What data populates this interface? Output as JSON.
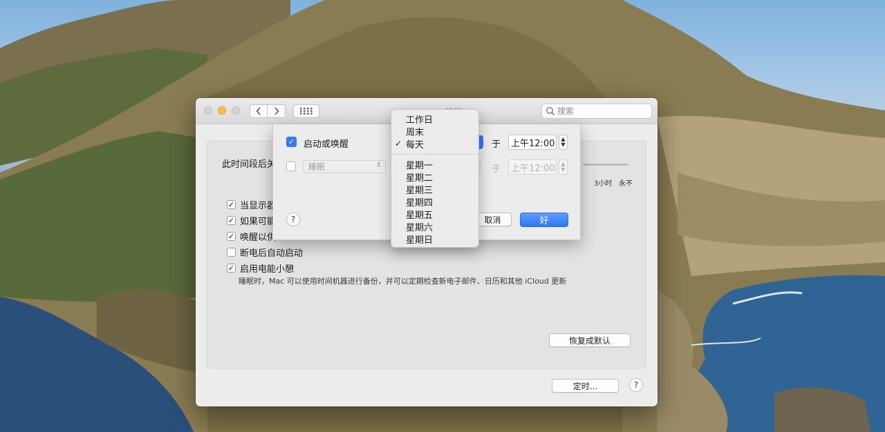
{
  "window": {
    "title": "节能",
    "search_placeholder": "搜索",
    "slider_label": "此时间段后关",
    "slider_ticks": [
      "3小时",
      "永不"
    ],
    "options": [
      {
        "label": "当显示器",
        "checked": true
      },
      {
        "label": "如果可能",
        "checked": true
      },
      {
        "label": "唤醒以供",
        "checked": true
      },
      {
        "label": "断电后自动启动",
        "checked": false
      },
      {
        "label": "启用电能小憩",
        "checked": true
      }
    ],
    "power_nap_desc": "睡眠时，Mac 可以使用时间机器进行备份，并可以定期检查新电子邮件、日历和其他 iCloud 更新",
    "restore_defaults": "恢复成默认",
    "schedule_button": "定时...",
    "help": "?"
  },
  "sheet": {
    "startup_label": "启动或唤醒",
    "startup_checked": true,
    "sleep_action": "睡眠",
    "sleep_checked": false,
    "at_label_1": "于",
    "time_1": "上午12:00",
    "at_label_2": "于",
    "time_2": "上午12:00",
    "cancel": "取消",
    "ok": "好",
    "help": "?"
  },
  "menu": {
    "group1": [
      {
        "label": "工作日",
        "checked": false
      },
      {
        "label": "周末",
        "checked": false
      },
      {
        "label": "每天",
        "checked": true
      }
    ],
    "group2": [
      {
        "label": "星期一"
      },
      {
        "label": "星期二"
      },
      {
        "label": "星期三"
      },
      {
        "label": "星期四"
      },
      {
        "label": "星期五"
      },
      {
        "label": "星期六"
      },
      {
        "label": "星期日"
      }
    ],
    "check_glyph": "✓"
  },
  "colors": {
    "accent": "#3478f6",
    "minimize": "#f5bf4f"
  }
}
